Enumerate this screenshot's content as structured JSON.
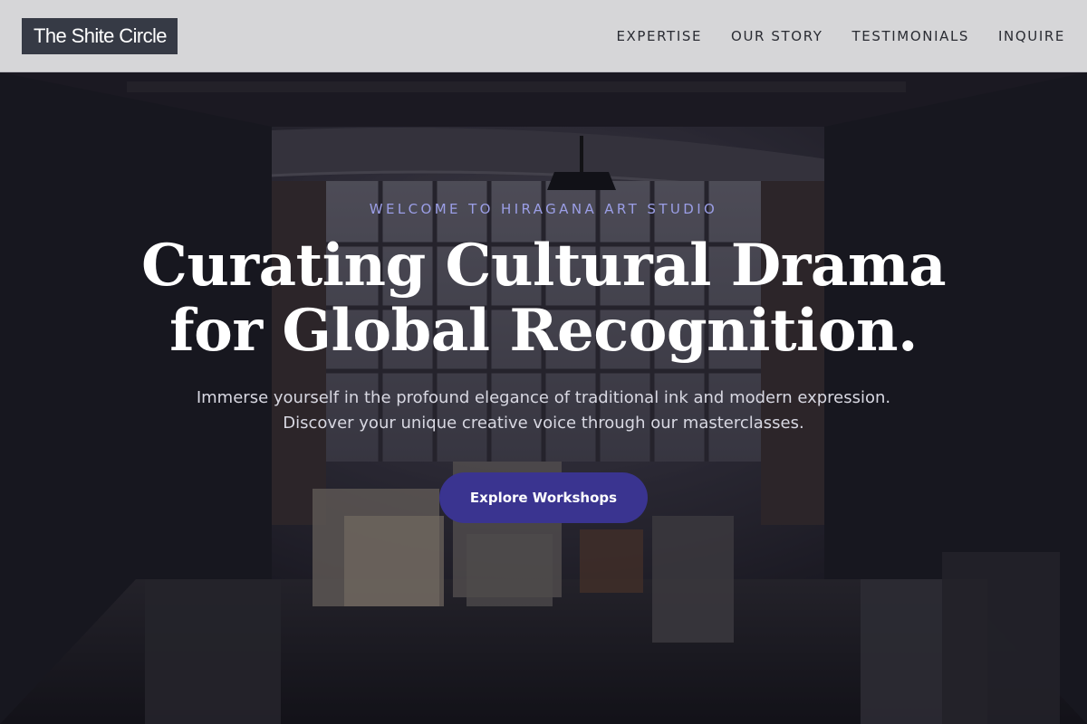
{
  "header": {
    "logo_text": "The Shite Circle",
    "nav": [
      {
        "label": "EXPERTISE"
      },
      {
        "label": "OUR STORY"
      },
      {
        "label": "TESTIMONIALS"
      },
      {
        "label": "INQUIRE"
      }
    ]
  },
  "hero": {
    "eyebrow": "WELCOME TO HIRAGANA ART STUDIO",
    "title_line1": "Curating Cultural Drama",
    "title_line2": "for Global Recognition.",
    "subtitle_line1": "Immerse yourself in the profound elegance of traditional ink and modern expression.",
    "subtitle_line2": "Discover your unique creative voice through our masterclasses.",
    "cta_label": "Explore Workshops"
  },
  "colors": {
    "header_bg": "#d6d6d8",
    "logo_bg": "#363a45",
    "eyebrow": "#9b9ee6",
    "cta_bg": "#3a3490"
  }
}
